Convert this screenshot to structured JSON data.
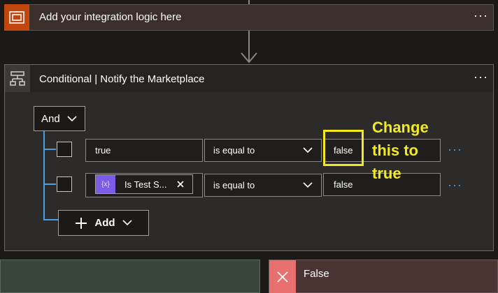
{
  "top_action": {
    "title": "Add your integration logic here",
    "menu": "···",
    "icon": "scope-icon",
    "accent": "#c2470f"
  },
  "conditional": {
    "title": "Conditional | Notify the Marketplace",
    "menu": "···",
    "icon": "condition-icon",
    "group_operator": "And",
    "rows": [
      {
        "left_value": "true",
        "operator": "is equal to",
        "right_value": "false"
      },
      {
        "left_token": "Is Test S...",
        "operator": "is equal to",
        "right_value": "false"
      }
    ],
    "row_menu": "···",
    "add_label": "Add"
  },
  "annotation": {
    "line1": "Change",
    "line2": "this to",
    "line3": "true",
    "color": "#f2ea1e"
  },
  "branches": {
    "false_label": "False"
  },
  "colors": {
    "link_blue": "#4aa0e6",
    "token_purple": "#7c5ce6",
    "false_red": "#e8716f"
  }
}
